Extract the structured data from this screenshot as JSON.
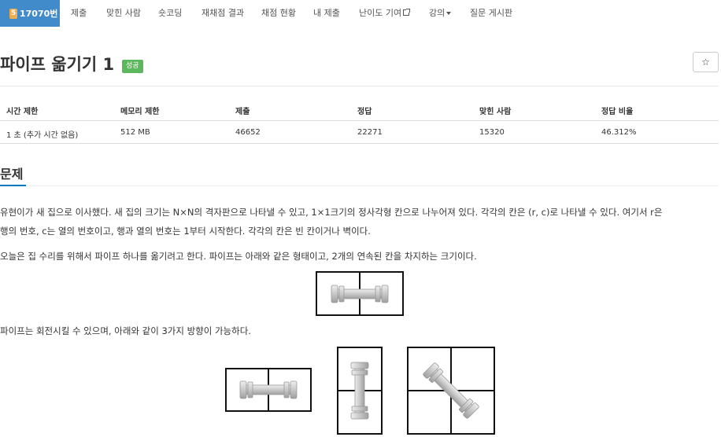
{
  "nav": {
    "active": {
      "badge": "5",
      "label": "17070번"
    },
    "items": [
      "제출",
      "맞힌 사람",
      "숏코딩",
      "재채점 결과",
      "채점 현황",
      "내 제출",
      "난이도 기여",
      "강의",
      "질문 게시판"
    ]
  },
  "problem": {
    "title": "파이프 옮기기 1",
    "status_badge": "성공",
    "star_icon": "☆"
  },
  "stats": {
    "headers": [
      "시간 제한",
      "메모리 제한",
      "제출",
      "정답",
      "맞힌 사람",
      "정답 비율"
    ],
    "values": [
      "1 초 (추가 시간 없음)",
      "512 MB",
      "46652",
      "22271",
      "15320",
      "46.312%"
    ]
  },
  "section": {
    "title": "문제"
  },
  "body": {
    "p1_line1": "유현이가 새 집으로 이사했다. 새 집의 크기는 N×N의 격자판으로 나타낼 수 있고, 1×1크기의 정사각형 칸으로 나누어져 있다. 각각의 칸은 (r, c)로 나타낼 수 있다. 여기서 r은",
    "p1_line2": "행의 번호, c는 열의 번호이고, 행과 열의 번호는 1부터 시작한다. 각각의 칸은 빈 칸이거나 벽이다.",
    "p2": "오늘은 집 수리를 위해서 파이프 하나를 옮기려고 한다. 파이프는 아래와 같은 형태이고, 2개의 연속된 칸을 차지하는 크기이다.",
    "p3": "파이프는 회전시킬 수 있으며, 아래와 같이 3가지 방향이 가능하다."
  },
  "colors": {
    "nav_active": "#428bca",
    "success": "#5cb85c",
    "tier": "#f0ad4e",
    "section_accent": "#0076c0"
  }
}
